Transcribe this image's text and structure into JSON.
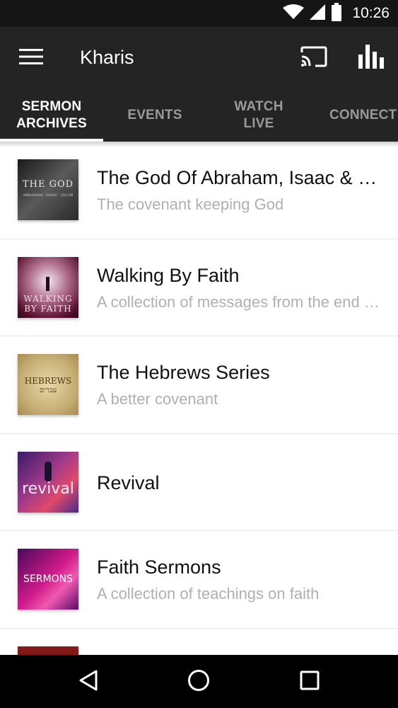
{
  "status": {
    "time": "10:26",
    "icons": [
      "wifi-icon",
      "signal-icon",
      "battery-icon"
    ]
  },
  "app_bar": {
    "title": "Kharis",
    "icons": [
      "menu-icon",
      "cast-icon",
      "bar-chart-icon"
    ]
  },
  "tabs": [
    {
      "label": "SERMON\nARCHIVES",
      "active": true
    },
    {
      "label": "EVENTS",
      "active": false
    },
    {
      "label": "WATCH\nLIVE",
      "active": false
    },
    {
      "label": "CONNECT",
      "active": false
    }
  ],
  "list": [
    {
      "title": "The God Of Abraham, Isaac & Jacob",
      "subtitle": "The covenant keeping God",
      "thumb_text": "THE GOD",
      "thumb_subtext": "ABRAHAM · ISAAC · JACOB"
    },
    {
      "title": "Walking By Faith",
      "subtitle": "A collection of messages from the end time",
      "thumb_text": "WALKING",
      "thumb_subtext": "BY FAITH"
    },
    {
      "title": "The Hebrews Series",
      "subtitle": "A better covenant",
      "thumb_text": "HEBREWS",
      "thumb_subtext": "עברים"
    },
    {
      "title": "Revival",
      "subtitle": "",
      "thumb_text": "revival"
    },
    {
      "title": "Faith Sermons",
      "subtitle": "A collection of teachings on faith",
      "thumb_text": "SERMONS"
    }
  ],
  "nav": {
    "icons": [
      "back-icon",
      "home-icon",
      "recents-icon"
    ]
  },
  "colors": {
    "app_bar": "#242424",
    "status_bar": "#151515",
    "tab_inactive": "#9a9a9a",
    "subtitle": "#b0b0b0"
  }
}
